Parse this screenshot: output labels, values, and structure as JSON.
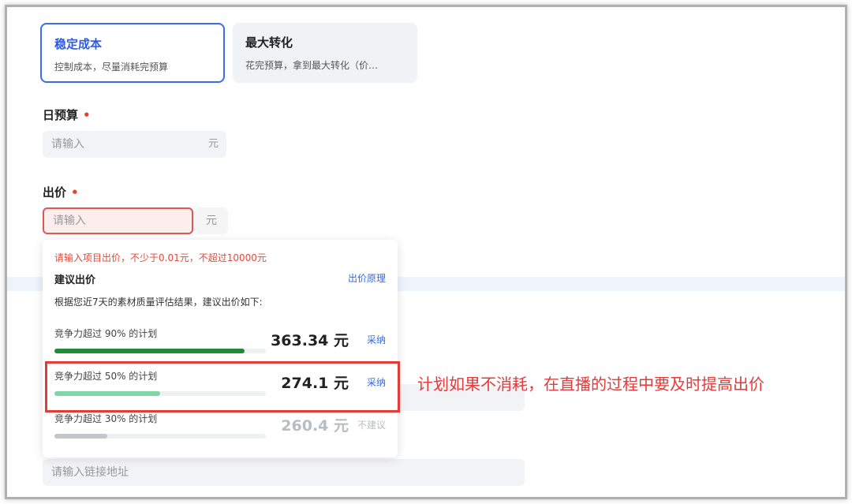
{
  "goal_cards": [
    {
      "title": "稳定成本",
      "desc": "控制成本，尽量消耗完预算"
    },
    {
      "title": "最大转化",
      "desc": "花完预算，拿到最大转化（价…"
    }
  ],
  "daily_budget": {
    "label": "日预算",
    "required": "•",
    "placeholder": "请输入",
    "unit": "元"
  },
  "bid": {
    "label": "出价",
    "required": "•",
    "placeholder": "请输入",
    "unit": "元"
  },
  "link_input": {
    "placeholder": "请输入链接地址"
  },
  "popup": {
    "error": "请输入项目出价，不少于0.01元，不超过10000元",
    "title": "建议出价",
    "link": "出价原理",
    "desc": "根据您近7天的素材质量评估结果，建议出价如下:",
    "options": [
      {
        "label": "竞争力超过 90% 的计划",
        "price": "363.34 元",
        "action": "采纳",
        "fill_percent": 90,
        "color": "#1f8a3a"
      },
      {
        "label": "竞争力超过 50% 的计划",
        "price": "274.1 元",
        "action": "采纳",
        "fill_percent": 50,
        "color": "#7fd6a7"
      },
      {
        "label": "竞争力超过 30% 的计划",
        "price": "260.4 元",
        "action": "不建议",
        "fill_percent": 25,
        "color": "#c4c6ca"
      }
    ]
  },
  "annotation": "计划如果不消耗，在直播的过程中要及时提高出价"
}
